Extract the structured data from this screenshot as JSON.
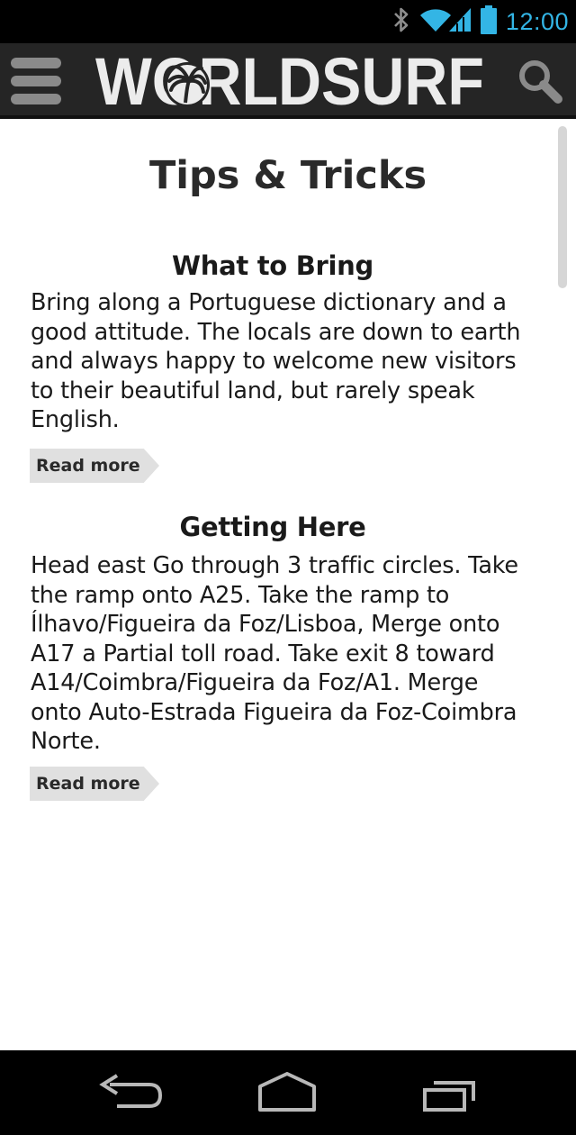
{
  "status_bar": {
    "time": "12:00",
    "icons": [
      "bluetooth-icon",
      "wifi-icon",
      "signal-icon",
      "battery-icon"
    ],
    "accent_color": "#33b5e5"
  },
  "app_bar": {
    "logo_text": "WORLDSURF",
    "menu_icon": "hamburger-menu-icon",
    "search_icon": "search-icon",
    "background_color": "#252525"
  },
  "page": {
    "title": "Tips & Tricks"
  },
  "tips": [
    {
      "heading": "What to Bring",
      "body": "Bring along a Portuguese dictionary and a good attitude. The locals are down to earth and always happy to welcome new visitors to their beautiful land, but rarely speak English.",
      "link": "Read more"
    },
    {
      "heading": "Getting Here",
      "body": "Head east Go through 3 traffic circles. Take the ramp onto A25. Take the ramp to Ílhavo/Figueira da Foz/Lisboa, Merge onto A17 a Partial toll road. Take exit 8 toward A14/Coimbra/Figueira da Foz/A1. Merge onto Auto-Estrada Figueira da Foz-Coimbra Norte.",
      "link": "Read more"
    }
  ],
  "nav_bar": {
    "icons": [
      "back-icon",
      "home-icon",
      "recent-apps-icon"
    ]
  }
}
